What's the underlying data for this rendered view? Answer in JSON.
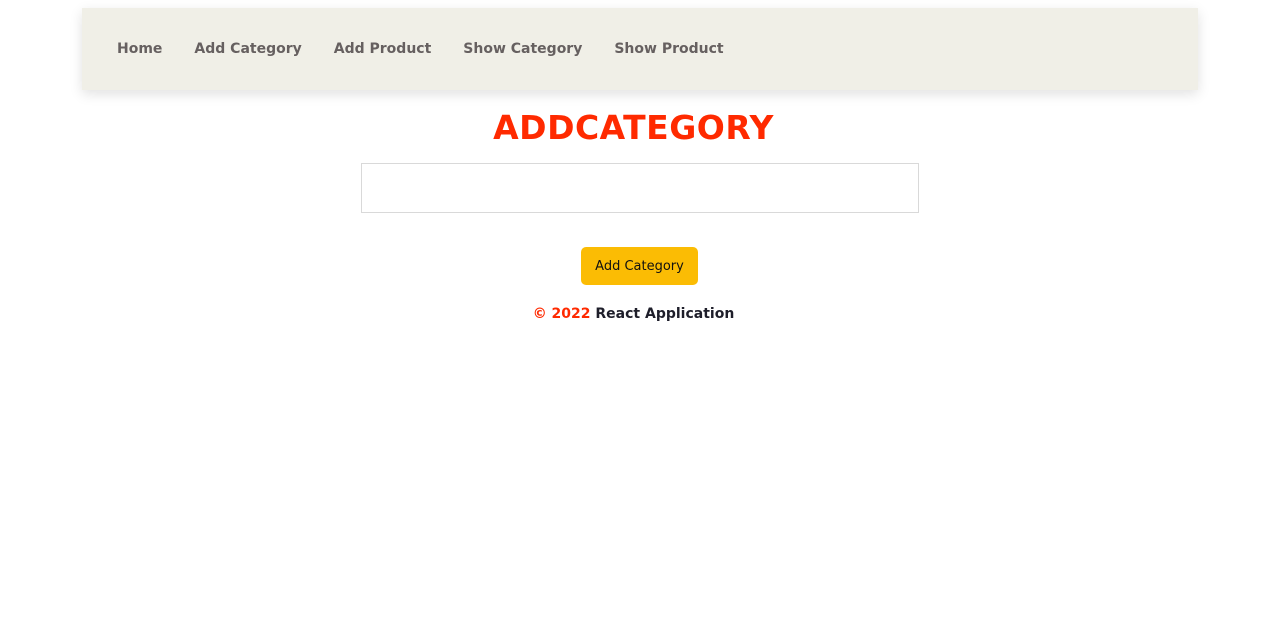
{
  "nav": {
    "items": [
      {
        "label": "Home"
      },
      {
        "label": "Add Category"
      },
      {
        "label": "Add Product"
      },
      {
        "label": "Show Category"
      },
      {
        "label": "Show Product"
      }
    ]
  },
  "main": {
    "heading": "ADDCATEGORY",
    "category_input": {
      "value": "",
      "placeholder": ""
    },
    "submit_label": "Add Category"
  },
  "footer": {
    "copyright": "© 2022",
    "app_name": "React Application"
  },
  "colors": {
    "accent": "#ff2a00",
    "button": "#fbbc04",
    "navbar_bg": "#f0efe7"
  }
}
